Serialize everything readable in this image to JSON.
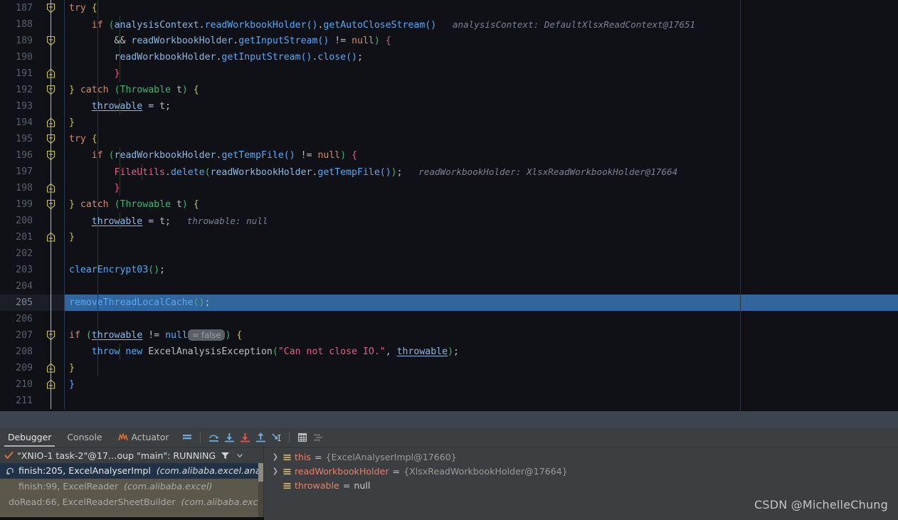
{
  "editor": {
    "first_line": 187,
    "current_line": 205,
    "margin_guide_x": 1040,
    "lines": [
      {
        "n": 187,
        "fold": "minus-expanded",
        "indent": 0,
        "html": "<span class=\"indent-guide\" style=\"left:46px\"></span><span class=\"kw\">try</span> <span class=\"par5\">{</span>",
        "hint": ""
      },
      {
        "n": 188,
        "fold": "",
        "indent": 1,
        "html": "<span class=\"indent-guide\" style=\"left:46px\"></span><span class=\"indent-guide\" style=\"left:77px\"></span>    <span class=\"kw\">if</span> <span class=\"par4\">(</span><span class=\"fld\">analysisContext</span><span class=\"id\">.</span><span class=\"mth\">readWorkbookHolder</span><span class=\"par2\">()</span><span class=\"id\">.</span><span class=\"mth\">getAutoCloseStream</span><span class=\"par2\">()</span>",
        "hint": "analysisContext: DefaultXlsxReadContext@17651"
      },
      {
        "n": 189,
        "fold": "minus-expanded",
        "indent": 2,
        "html": "<span class=\"indent-guide\" style=\"left:46px\"></span><span class=\"indent-guide\" style=\"left:77px\"></span>        <span class=\"op\">&amp;&amp;</span> <span class=\"fld\">readWorkbookHolder</span><span class=\"id\">.</span><span class=\"mth\">getInputStream</span><span class=\"par2\">()</span> <span class=\"op\">!=</span> <span class=\"kw\">null</span><span class=\"par4\">)</span> <span class=\"par3\">{</span>",
        "hint": ""
      },
      {
        "n": 190,
        "fold": "",
        "indent": 2,
        "html": "<span class=\"indent-guide\" style=\"left:46px\"></span><span class=\"indent-guide\" style=\"left:77px\"></span>        <span class=\"fld\">readWorkbookHolder</span><span class=\"id\">.</span><span class=\"mth\">getInputStream</span><span class=\"par2\">()</span><span class=\"id\">.</span><span class=\"mth\">close</span><span class=\"par2\">()</span><span class=\"id\">;</span>",
        "hint": ""
      },
      {
        "n": 191,
        "fold": "minus-end",
        "indent": 2,
        "html": "<span class=\"indent-guide\" style=\"left:46px\"></span><span class=\"indent-guide\" style=\"left:77px\"></span>        <span class=\"par3\">}</span>",
        "hint": ""
      },
      {
        "n": 192,
        "fold": "minus-expanded",
        "indent": 0,
        "html": "<span class=\"indent-guide\" style=\"left:46px\"></span><span class=\"par5\">}</span> <span class=\"kw\">catch</span> <span class=\"par4\">(</span><span class=\"green\">Throwable</span> <span class=\"id\">t</span><span class=\"par4\">)</span> <span class=\"par5\">{</span>",
        "hint": ""
      },
      {
        "n": 193,
        "fold": "",
        "indent": 1,
        "html": "<span class=\"indent-guide\" style=\"left:46px\"></span><span class=\"indent-guide\" style=\"left:77px\"></span>    <span class=\"fldu\">throwable</span> <span class=\"op\">=</span> <span class=\"id\">t</span><span class=\"id\">;</span>",
        "hint": ""
      },
      {
        "n": 194,
        "fold": "minus-end",
        "indent": 0,
        "html": "<span class=\"indent-guide\" style=\"left:46px\"></span><span class=\"par5\">}</span>",
        "hint": ""
      },
      {
        "n": 195,
        "fold": "minus-expanded",
        "indent": 0,
        "html": "<span class=\"indent-guide\" style=\"left:46px\"></span><span class=\"kw\">try</span> <span class=\"par5\">{</span>",
        "hint": ""
      },
      {
        "n": 196,
        "fold": "minus-expanded",
        "indent": 1,
        "html": "<span class=\"indent-guide\" style=\"left:46px\"></span><span class=\"indent-guide\" style=\"left:77px\"></span>    <span class=\"kw\">if</span> <span class=\"par4\">(</span><span class=\"fld\">readWorkbookHolder</span><span class=\"id\">.</span><span class=\"mth\">getTempFile</span><span class=\"par2\">()</span> <span class=\"op\">!=</span> <span class=\"kw\">null</span><span class=\"par4\">)</span> <span class=\"par3\">{</span>",
        "hint": ""
      },
      {
        "n": 197,
        "fold": "",
        "indent": 2,
        "html": "<span class=\"indent-guide\" style=\"left:46px\"></span><span class=\"indent-guide\" style=\"left:77px\"></span><span class=\"indent-guide\" style=\"left:108px\"></span>        <span class=\"str\">FileUtils</span><span class=\"id\">.</span><span class=\"mth\">delete</span><span class=\"par4\">(</span><span class=\"fld\">readWorkbookHolder</span><span class=\"id\">.</span><span class=\"mth\">getTempFile</span><span class=\"par2\">()</span><span class=\"par4\">)</span><span class=\"id\">;</span>",
        "hint": "readWorkbookHolder: XlsxReadWorkbookHolder@17664"
      },
      {
        "n": 198,
        "fold": "minus-end",
        "indent": 2,
        "html": "<span class=\"indent-guide\" style=\"left:46px\"></span><span class=\"indent-guide\" style=\"left:77px\"></span>        <span class=\"par3\">}</span>",
        "hint": ""
      },
      {
        "n": 199,
        "fold": "minus-expanded",
        "indent": 0,
        "html": "<span class=\"indent-guide\" style=\"left:46px\"></span><span class=\"par5\">}</span> <span class=\"kw\">catch</span> <span class=\"par4\">(</span><span class=\"green\">Throwable</span> <span class=\"id\">t</span><span class=\"par4\">)</span> <span class=\"par5\">{</span>",
        "hint": ""
      },
      {
        "n": 200,
        "fold": "",
        "indent": 1,
        "html": "<span class=\"indent-guide\" style=\"left:46px\"></span><span class=\"indent-guide\" style=\"left:77px\"></span>    <span class=\"fldu\">throwable</span> <span class=\"op\">=</span> <span class=\"id\">t</span><span class=\"id\">;</span>",
        "hint": "throwable: null"
      },
      {
        "n": 201,
        "fold": "minus-end",
        "indent": 0,
        "html": "<span class=\"indent-guide\" style=\"left:46px\"></span><span class=\"par5\">}</span>",
        "hint": ""
      },
      {
        "n": 202,
        "fold": "",
        "indent": 0,
        "html": "<span class=\"indent-guide\" style=\"left:46px\"></span>",
        "hint": ""
      },
      {
        "n": 203,
        "fold": "",
        "indent": 0,
        "html": "<span class=\"indent-guide\" style=\"left:46px\"></span><span class=\"mth\">clearEncrypt03</span><span class=\"par4\">()</span><span class=\"id\">;</span>",
        "hint": ""
      },
      {
        "n": 204,
        "fold": "",
        "indent": 0,
        "html": "<span class=\"indent-guide\" style=\"left:46px\"></span>",
        "hint": ""
      },
      {
        "n": 205,
        "fold": "",
        "indent": 0,
        "html": "<span class=\"indent-guide\" style=\"left:46px\"></span><span class=\"mth\">removeThreadLocalCache</span><span class=\"par4\">()</span><span class=\"id\">;</span>",
        "hint": ""
      },
      {
        "n": 206,
        "fold": "",
        "indent": 0,
        "html": "<span class=\"indent-guide\" style=\"left:46px\"></span>",
        "hint": ""
      },
      {
        "n": 207,
        "fold": "minus-expanded",
        "indent": 0,
        "html": "<span class=\"indent-guide\" style=\"left:46px\"></span><span class=\"kw\">if</span> <span class=\"par4\">(</span><span class=\"fldu\">throwable</span> <span class=\"op\">!=</span> <span class=\"mth\">null</span><span class=\"badge\">= false</span><span class=\"par4\">)</span> <span class=\"par5\">{</span>",
        "hint": ""
      },
      {
        "n": 208,
        "fold": "",
        "indent": 1,
        "html": "<span class=\"indent-guide\" style=\"left:46px\"></span><span class=\"indent-guide\" style=\"left:77px\"></span>    <span class=\"kw2\" style=\"color:#56a8f5\">throw</span> <span class=\"kw2\" style=\"color:#56a8f5\">new</span> <span class=\"id\">ExcelAnalysisException</span><span class=\"par4\">(</span><span class=\"str\">\"Can not close IO.\"</span><span class=\"id\">,</span> <span class=\"fldu\">throwable</span><span class=\"par4\">)</span><span class=\"id\">;</span>",
        "hint": ""
      },
      {
        "n": 209,
        "fold": "minus-end",
        "indent": 0,
        "html": "<span class=\"indent-guide\" style=\"left:46px\"></span><span class=\"par5\">}</span>",
        "hint": ""
      },
      {
        "n": 210,
        "fold": "minus-end",
        "indent": 0,
        "html": "<span class=\"par2\">}</span>",
        "hint": ""
      },
      {
        "n": 211,
        "fold": "",
        "indent": 0,
        "html": "",
        "hint": ""
      }
    ]
  },
  "debug": {
    "tabs": [
      {
        "label": "Debugger",
        "active": true,
        "icon": ""
      },
      {
        "label": "Console",
        "active": false,
        "icon": ""
      },
      {
        "label": "Actuator",
        "active": false,
        "icon": "actuator-icon"
      }
    ],
    "toolbar_icons": [
      "show-execution-point-icon",
      "step-over-icon",
      "step-into-icon",
      "force-step-into-icon",
      "step-out-icon",
      "run-to-cursor-icon",
      "evaluate-expression-icon",
      "settings-icon"
    ],
    "thread": {
      "status_icon": "check-icon",
      "label": "\"XNIO-1 task-2\"@17…oup \"main\": RUNNING",
      "filter_icon": "filter-icon",
      "dropdown_icon": "chevron-down-icon"
    },
    "frames": [
      {
        "icon": "reset-frame-icon",
        "method": "finish:205, ExcelAnalyserImpl",
        "pkg": "(com.alibaba.excel.analysis)",
        "selected": true
      },
      {
        "icon": "",
        "method": "finish:99, ExcelReader",
        "pkg": "(com.alibaba.excel)",
        "selected": false
      },
      {
        "icon": "",
        "method": "doRead:66, ExcelReaderSheetBuilder",
        "pkg": "(com.alibaba.excel.r",
        "selected": false
      }
    ],
    "variables": [
      {
        "expandable": true,
        "name": "this",
        "value": "{ExcelAnalyserImpl@17660}",
        "is_null": false
      },
      {
        "expandable": true,
        "name": "readWorkbookHolder",
        "value": "{XlsxReadWorkbookHolder@17664}",
        "is_null": false
      },
      {
        "expandable": false,
        "name": "throwable",
        "value": "null",
        "is_null": true
      }
    ]
  },
  "watermark": {
    "text": "CSDN @MichelleChung"
  },
  "colors": {
    "editor_bg": "#0f1117",
    "current_line": "#32659c",
    "panel_bg": "#3c3f41",
    "frames_bg": "#5c574b",
    "frame_selected": "#1f3247",
    "var_name": "#e8806a",
    "accent_blue": "#56a8f5",
    "fold_yellow": "#c9c14b"
  }
}
